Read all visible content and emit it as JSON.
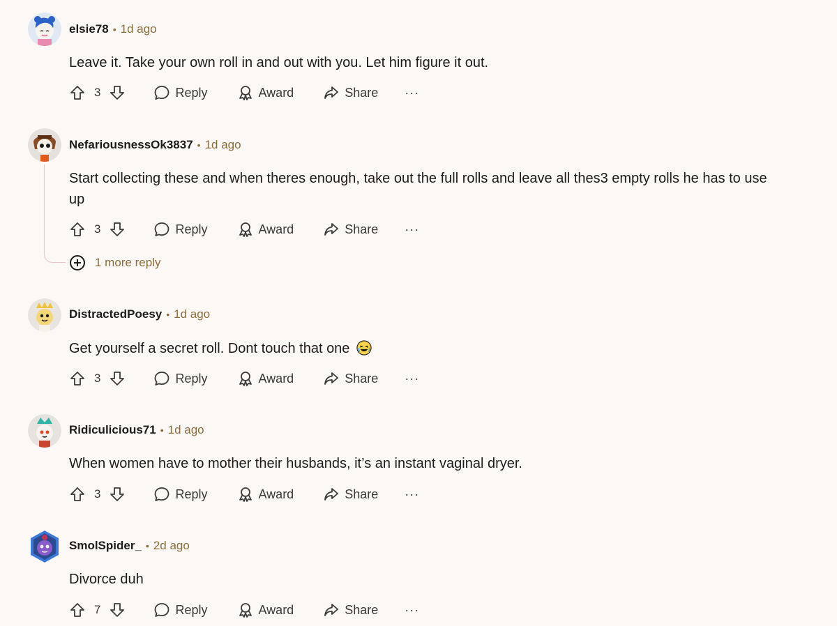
{
  "comments": [
    {
      "username": "elsie78",
      "time": "1d ago",
      "text": "Leave it. Take your own roll in and out with you. Let him figure it out.",
      "votes": "3",
      "reply_label": "Reply",
      "award_label": "Award",
      "share_label": "Share",
      "more_label": "···"
    },
    {
      "username": "NefariousnessOk3837",
      "time": "1d ago",
      "text": "Start collecting these and when theres enough, take out the full rolls and leave all thes3 empty rolls he has to use up",
      "votes": "3",
      "reply_label": "Reply",
      "award_label": "Award",
      "share_label": "Share",
      "more_label": "···",
      "more_replies": "1 more reply"
    },
    {
      "username": "DistractedPoesy",
      "time": "1d ago",
      "text": "Get yourself a secret roll. Dont touch that one",
      "votes": "3",
      "reply_label": "Reply",
      "award_label": "Award",
      "share_label": "Share",
      "more_label": "···"
    },
    {
      "username": "Ridiculicious71",
      "time": "1d ago",
      "text": "When women have to mother their husbands, it’s an instant vaginal dryer.",
      "votes": "3",
      "reply_label": "Reply",
      "award_label": "Award",
      "share_label": "Share",
      "more_label": "···"
    },
    {
      "username": "SmolSpider_",
      "time": "2d ago",
      "text": "Divorce duh",
      "votes": "7",
      "reply_label": "Reply",
      "award_label": "Award",
      "share_label": "Share",
      "more_label": "···"
    }
  ],
  "meta_separator": "•",
  "colors": {
    "background": "#fcf8f5",
    "meta_text": "#8a6d3b",
    "thread_line": "#e7c5cf"
  },
  "icons": [
    "upvote-icon",
    "downvote-icon",
    "comment-bubble-icon",
    "award-icon",
    "share-arrow-icon",
    "more-options-icon",
    "expand-plus-icon",
    "laughing-emoji-icon"
  ]
}
